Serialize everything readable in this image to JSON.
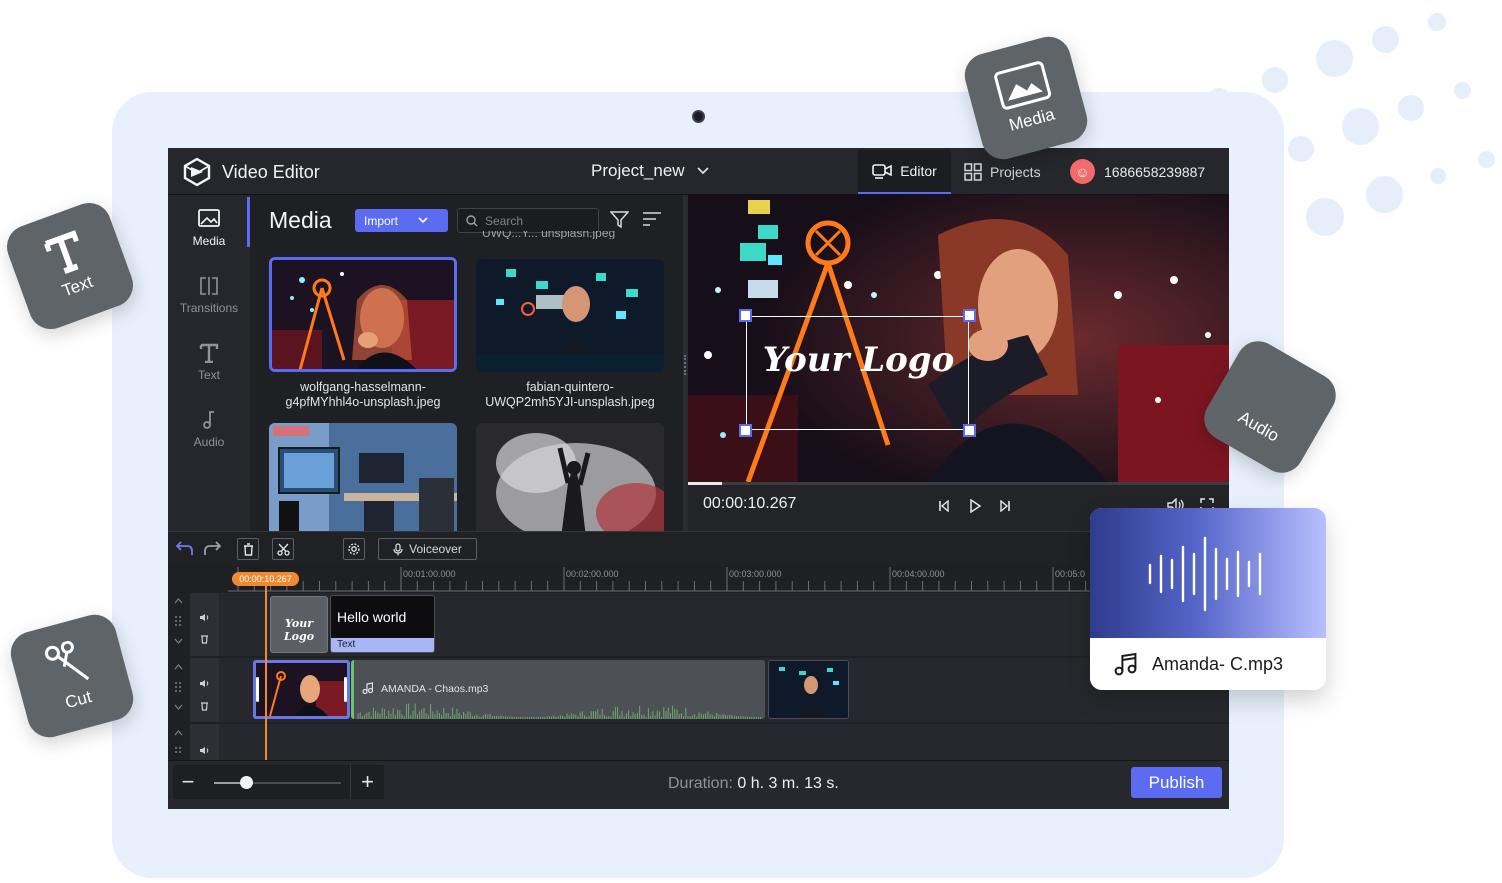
{
  "app": {
    "name": "Video Editor",
    "project_name": "Project_new",
    "tabs": [
      {
        "label": "Editor",
        "active": true
      },
      {
        "label": "Projects",
        "active": false
      }
    ],
    "user_id": "1686658239887",
    "accent_color": "#5b6cf2"
  },
  "sidebar": {
    "items": [
      {
        "label": "Media",
        "icon": "image-icon",
        "active": true
      },
      {
        "label": "Transitions",
        "icon": "transitions-icon",
        "active": false
      },
      {
        "label": "Text",
        "icon": "text-icon",
        "active": false
      },
      {
        "label": "Audio",
        "icon": "music-note-icon",
        "active": false
      }
    ]
  },
  "media": {
    "title": "Media",
    "import_label": "Import",
    "search_placeholder": "Search",
    "clipped_filename": "UWQ...Y... unsplash.jpeg",
    "files": [
      {
        "name": "wolfgang-hasselmann-g4pfMYhhl4o-unsplash.jpeg",
        "line1": "wolfgang-hasselmann-",
        "line2": "g4pfMYhhl4o-unsplash.jpeg",
        "selected": true
      },
      {
        "name": "fabian-quintero-UWQP2mh5YJI-unsplash.jpeg",
        "line1": "fabian-quintero-",
        "line2": "UWQP2mh5YJI-unsplash.jpeg",
        "selected": false
      },
      {
        "name": "",
        "line1": "",
        "line2": "",
        "selected": false
      },
      {
        "name": "",
        "line1": "",
        "line2": "",
        "selected": false
      }
    ]
  },
  "preview": {
    "overlay_text": "Your Logo",
    "timecode": "00:00:10.267"
  },
  "timeline_toolbar": {
    "voiceover_label": "Voiceover"
  },
  "ruler": {
    "playhead_time": "00:00:10.267",
    "marks": [
      "00:01:00.000",
      "00:02:00.000",
      "00:03:00.000",
      "00:04:00.000",
      "00:05:0"
    ]
  },
  "tracks": {
    "text_clip": {
      "logo_label": "Your Logo",
      "title": "Hello world",
      "tag": "Text"
    },
    "audio_clip": {
      "name": "AMANDA - Chaos.mp3"
    }
  },
  "footer": {
    "duration_label": "Duration:",
    "duration_value": "0 h. 3 m. 13 s.",
    "zoom_level": 0.25,
    "publish_label": "Publish"
  },
  "badges": {
    "media": "Media",
    "text": "Text",
    "audio": "Audio",
    "cut": "Cut"
  },
  "audio_card": {
    "filename": "Amanda- C.mp3"
  }
}
